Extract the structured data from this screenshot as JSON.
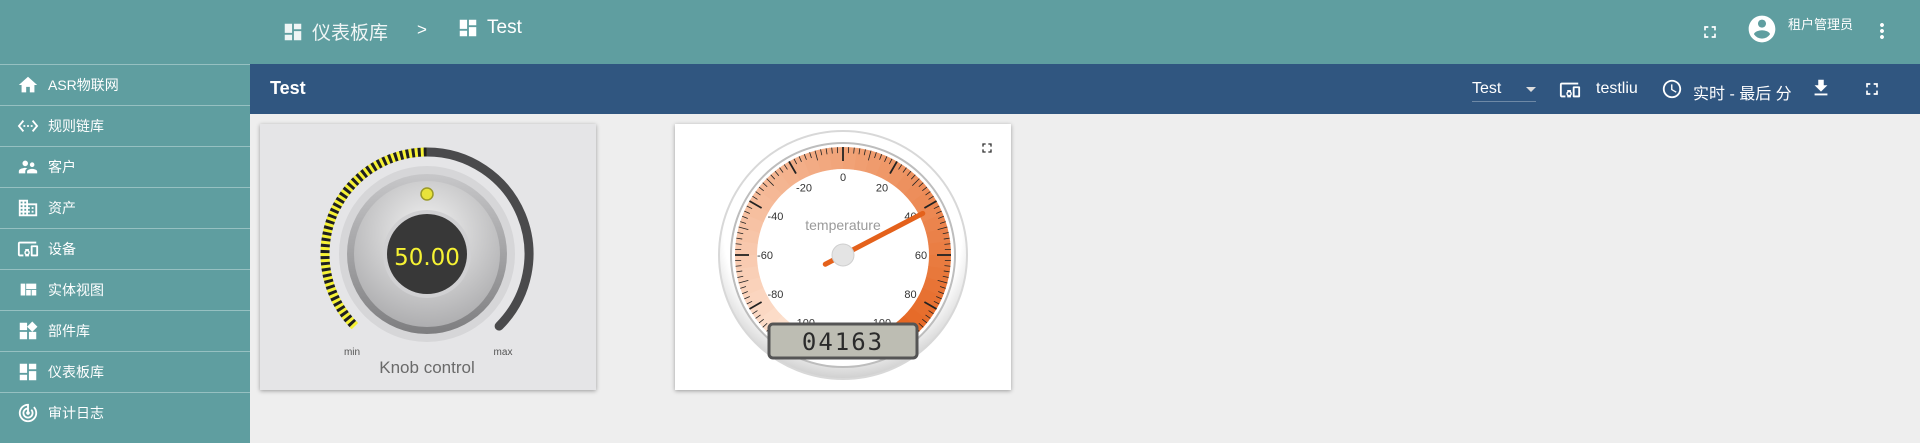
{
  "sidebar": {
    "items": [
      {
        "label": "ASR物联网",
        "icon": "home-icon"
      },
      {
        "label": "规则链库",
        "icon": "settings-ethernet-icon"
      },
      {
        "label": "客户",
        "icon": "supervisor-account-icon"
      },
      {
        "label": "资产",
        "icon": "domain-icon"
      },
      {
        "label": "设备",
        "icon": "devices-other-icon"
      },
      {
        "label": "实体视图",
        "icon": "view-quilt-icon"
      },
      {
        "label": "部件库",
        "icon": "widgets-icon"
      },
      {
        "label": "仪表板库",
        "icon": "dashboard-icon"
      },
      {
        "label": "审计日志",
        "icon": "track-changes-icon"
      }
    ]
  },
  "topbar": {
    "breadcrumb": [
      {
        "label": "仪表板库",
        "icon": "dashboard-icon"
      },
      {
        "label": "Test",
        "icon": "dashboard-icon"
      }
    ],
    "separator": ">",
    "username": "租户管理员"
  },
  "dashboard": {
    "title": "Test",
    "state": "Test",
    "entity_alias": "testliu",
    "timewindow": "实时 - 最后 分"
  },
  "knob_widget": {
    "value": "50.00",
    "min_label": "min",
    "max_label": "max",
    "title": "Knob control",
    "level_fraction": 0.5
  },
  "gauge_widget": {
    "label": "temperature",
    "value": 41.63,
    "lcd": "04163",
    "min": -100,
    "max": 100,
    "ticks": [
      "-100",
      "-80",
      "-60",
      "-40",
      "-20",
      "0",
      "20",
      "40",
      "60",
      "80",
      "100"
    ]
  },
  "colors": {
    "sidebar": "#5f9ea0",
    "dash_header": "#305680",
    "knob_active": "#f6f233",
    "gauge_needle": "#e4611b",
    "gauge_band_high": "#e4611b"
  }
}
